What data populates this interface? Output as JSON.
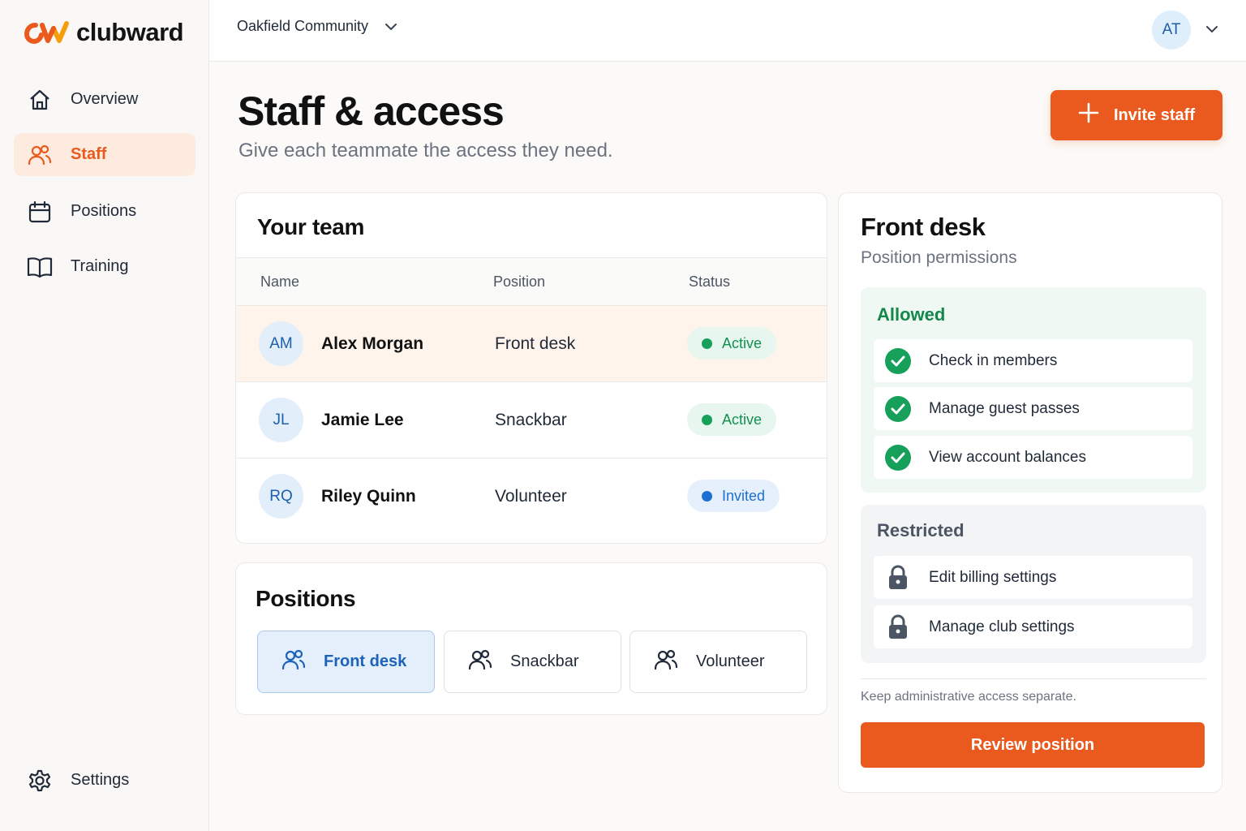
{
  "brand": {
    "name": "clubward",
    "accent": "#ea5a1e"
  },
  "sidebar": {
    "items": [
      {
        "label": "Overview",
        "icon": "home-icon",
        "active": false
      },
      {
        "label": "Staff",
        "icon": "users-icon",
        "active": true
      },
      {
        "label": "Positions",
        "icon": "calendar-icon",
        "active": false
      },
      {
        "label": "Training",
        "icon": "book-icon",
        "active": false
      }
    ],
    "settings": {
      "label": "Settings",
      "icon": "gear-icon"
    }
  },
  "topbar": {
    "organization": "Oakfield Community",
    "user_initials": "AT"
  },
  "header": {
    "title": "Staff & access",
    "subtitle": "Give each teammate the access they need.",
    "invite_label": "Invite staff"
  },
  "team": {
    "title": "Your team",
    "columns": [
      "Name",
      "Position",
      "Status"
    ],
    "rows": [
      {
        "initials": "AM",
        "name": "Alex Morgan",
        "position": "Front desk",
        "status": "Active",
        "selected": true
      },
      {
        "initials": "JL",
        "name": "Jamie Lee",
        "position": "Snackbar",
        "status": "Active",
        "selected": false
      },
      {
        "initials": "RQ",
        "name": "Riley Quinn",
        "position": "Volunteer",
        "status": "Invited",
        "selected": false
      }
    ]
  },
  "positions": {
    "title": "Positions",
    "items": [
      {
        "label": "Front desk",
        "selected": true
      },
      {
        "label": "Snackbar",
        "selected": false
      },
      {
        "label": "Volunteer",
        "selected": false
      }
    ]
  },
  "detail": {
    "title": "Front desk",
    "subtitle": "Position permissions",
    "allowed": {
      "title": "Allowed",
      "items": [
        "Check in members",
        "Manage guest passes",
        "View account balances"
      ]
    },
    "restricted": {
      "title": "Restricted",
      "items": [
        "Edit billing settings",
        "Manage club settings"
      ]
    },
    "note": "Keep administrative access separate.",
    "review_label": "Review position"
  }
}
